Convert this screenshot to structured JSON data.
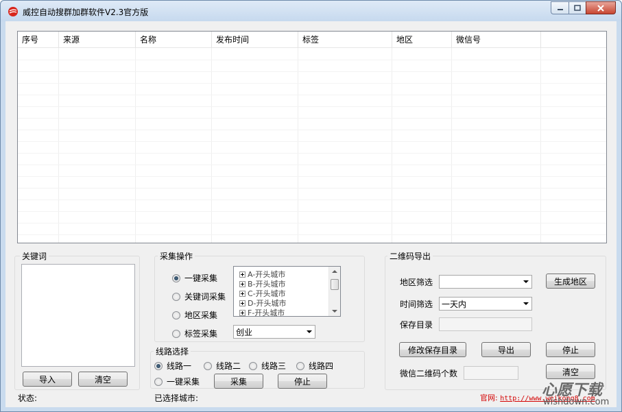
{
  "window": {
    "title": "威控自动搜群加群软件V2.3官方版"
  },
  "table": {
    "columns": [
      "序号",
      "来源",
      "名称",
      "发布时间",
      "标签",
      "地区",
      "微信号"
    ],
    "rows": []
  },
  "keywords": {
    "label": "关键词",
    "import_label": "导入",
    "clear_label": "清空"
  },
  "collect": {
    "label": "采集操作",
    "modes": [
      "一键采集",
      "关键词采集",
      "地区采集",
      "标签采集"
    ],
    "selected_mode": "一键采集",
    "cities": [
      "A-开头城市",
      "B-开头城市",
      "C-开头城市",
      "D-开头城市",
      "F-开头城市"
    ],
    "tag_value": "创业"
  },
  "route": {
    "label": "线路选择",
    "options": [
      "线路一",
      "线路二",
      "线路三",
      "线路四",
      "一键采集"
    ],
    "selected": "线路一",
    "collect_label": "采集",
    "stop_label": "停止"
  },
  "qr": {
    "label": "二维码导出",
    "region_filter_label": "地区筛选",
    "region_filter_value": "",
    "generate_region_label": "生成地区",
    "time_filter_label": "时间筛选",
    "time_filter_value": "一天内",
    "save_dir_label": "保存目录",
    "save_dir_value": "",
    "modify_dir_label": "修改保存目录",
    "export_label": "导出",
    "stop_label": "停止",
    "count_label": "微信二维码个数",
    "count_value": "",
    "clear_label": "清空"
  },
  "status": {
    "status_label": "状态:",
    "city_label": "已选择城市:",
    "official_label": "官网:",
    "official_url": "http://www.weikong8.com"
  },
  "watermark": {
    "text": "心愿下载",
    "sub": "wishdown.com"
  },
  "colors": {
    "accent_red": "#d40000",
    "window_frame": "#c9dbee",
    "client_bg": "#f0f0f0"
  }
}
